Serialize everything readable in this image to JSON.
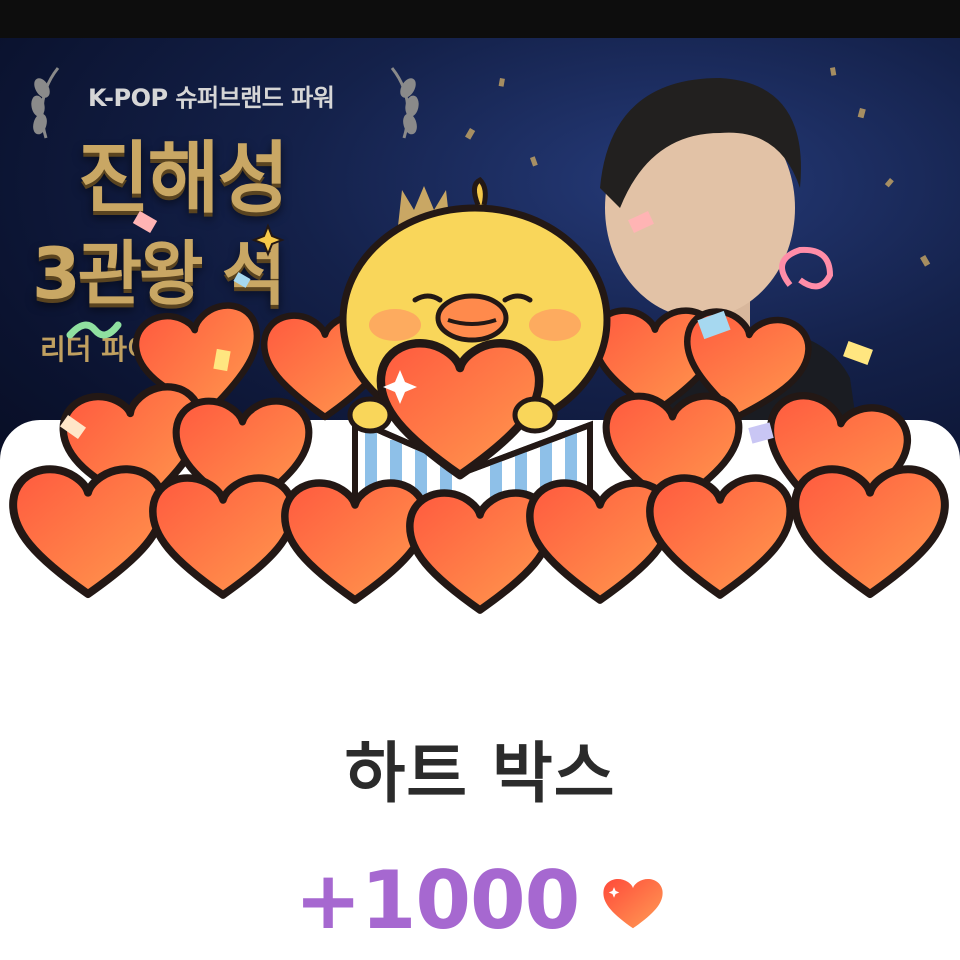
{
  "banner": {
    "subtitle": "K-POP 슈퍼브랜드 파워",
    "name": "진해성",
    "title": "3관왕 석",
    "caption": "리더 파이"
  },
  "reward": {
    "title": "하트 박스",
    "amount": "+1000",
    "icon": "heart-icon"
  },
  "colors": {
    "amount": "#a668d0",
    "heart": "#f06a45",
    "title_text": "#2b2b2b"
  }
}
